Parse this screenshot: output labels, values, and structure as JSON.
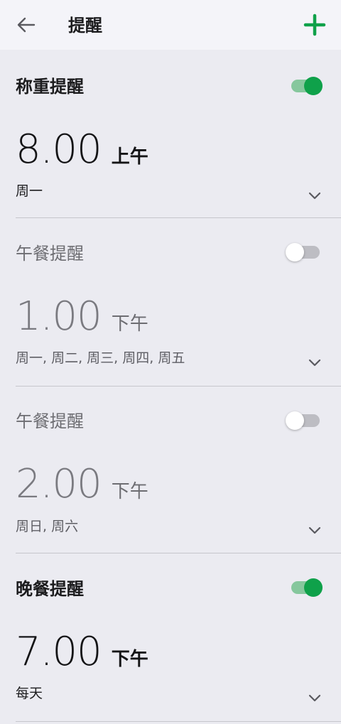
{
  "appbar": {
    "title": "提醒"
  },
  "reminders": [
    {
      "title": "称重提醒",
      "enabled": true,
      "time": "8.00",
      "ampm": "上午",
      "days": "周一"
    },
    {
      "title": "午餐提醒",
      "enabled": false,
      "time": "1.00",
      "ampm": "下午",
      "days": "周一, 周二, 周三, 周四, 周五"
    },
    {
      "title": "午餐提醒",
      "enabled": false,
      "time": "2.00",
      "ampm": "下午",
      "days": "周日, 周六"
    },
    {
      "title": "晚餐提醒",
      "enabled": true,
      "time": "7.00",
      "ampm": "下午",
      "days": "每天"
    }
  ],
  "colors": {
    "accent": "#0fa14a",
    "background": "#ebebf1",
    "appbar": "#f4f4f9"
  },
  "icons": {
    "back": "arrow-left-icon",
    "add": "plus-icon",
    "expand": "chevron-down-icon"
  }
}
